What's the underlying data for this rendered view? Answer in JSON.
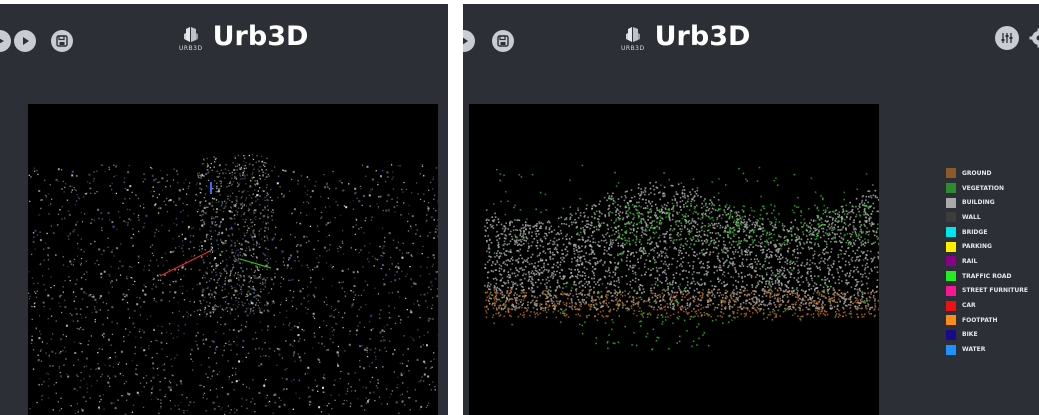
{
  "left_panel": {
    "title": "Urb3D",
    "logo_text": "URB3D",
    "toolbar": [
      {
        "icon": "play-icon"
      },
      {
        "icon": "play-icon"
      },
      {
        "icon": "save-icon"
      }
    ]
  },
  "right_panel": {
    "title": "Urb3D",
    "logo_text": "URB3D",
    "toolbar_left": [
      {
        "icon": "play-icon"
      },
      {
        "icon": "save-icon"
      }
    ],
    "toolbar_right": [
      {
        "icon": "sliders-icon"
      },
      {
        "icon": "settings-icon"
      }
    ],
    "legend": [
      {
        "label": "GROUND",
        "color": "#8b5a2b"
      },
      {
        "label": "VEGETATION",
        "color": "#2e8b2e"
      },
      {
        "label": "BUILDING",
        "color": "#a9a9a9"
      },
      {
        "label": "WALL",
        "color": "#3c3c3c"
      },
      {
        "label": "BRIDGE",
        "color": "#00e5ee"
      },
      {
        "label": "PARKING",
        "color": "#ffee00"
      },
      {
        "label": "RAIL",
        "color": "#8b008b"
      },
      {
        "label": "TRAFFIC ROAD",
        "color": "#22ee22"
      },
      {
        "label": "STREET FURNITURE",
        "color": "#ff1493"
      },
      {
        "label": "CAR",
        "color": "#ee1111"
      },
      {
        "label": "FOOTPATH",
        "color": "#ff8c1a"
      },
      {
        "label": "BIKE",
        "color": "#1a0a8b"
      },
      {
        "label": "WATER",
        "color": "#1e90ff"
      }
    ]
  }
}
